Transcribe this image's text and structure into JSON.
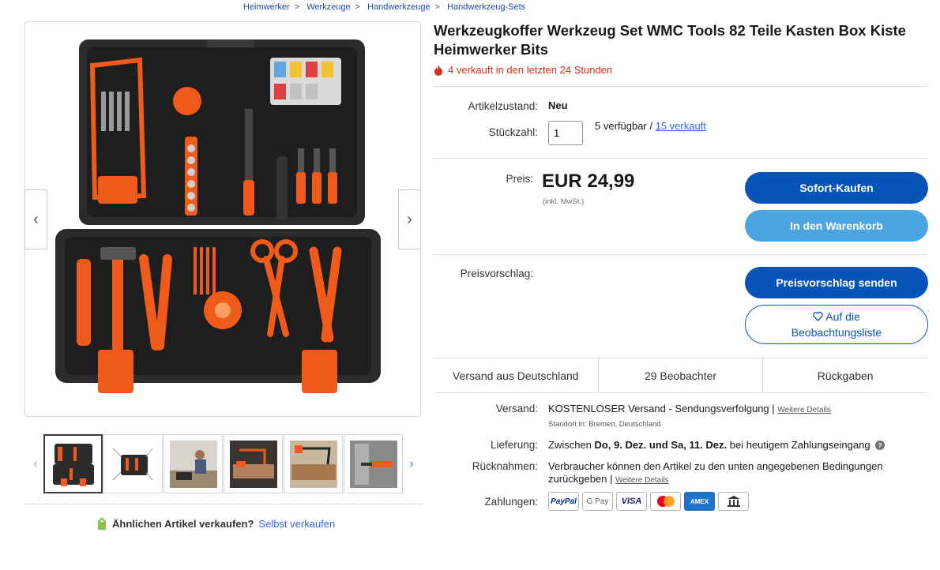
{
  "breadcrumb": [
    "Heimwerker",
    "Werkzeuge",
    "Handwerkzeuge",
    "Handwerkzeug-Sets"
  ],
  "breadcrumb_sep": ">",
  "listing": {
    "title": "Werkzeugkoffer Werkzeug Set WMC Tools 82 Teile Kasten Box Kiste Heimwerker Bits",
    "urgency": "4 verkauft in den letzten 24 Stunden"
  },
  "details": {
    "condition_label": "Artikelzustand:",
    "condition_value": "Neu",
    "quantity_label": "Stückzahl:",
    "quantity_value": "1",
    "available_text": "5 verfügbar / ",
    "sold_link": "15 verkauft"
  },
  "price": {
    "label": "Preis:",
    "value": "EUR 24,99",
    "tax_note": "(inkl. MwSt.)"
  },
  "buttons": {
    "buy_now": "Sofort-Kaufen",
    "add_to_cart": "In den Warenkorb",
    "offer_label": "Preisvorschlag:",
    "send_offer": "Preisvorschlag senden",
    "watchlist": "Auf die Beobachtungsliste"
  },
  "stats": [
    "Versand aus Deutschland",
    "29 Beobachter",
    "Rückgaben"
  ],
  "shipping": {
    "label": "Versand:",
    "value": "KOSTENLOSER Versand - Sendungsverfolgung",
    "details_link": "Weitere Details",
    "location": "Standort in:  Bremen, Deutschland"
  },
  "delivery": {
    "label": "Lieferung:",
    "prefix": "Zwischen ",
    "dates": "Do, 9. Dez. und Sa, 11. Dez.",
    "suffix": " bei heutigem Zahlungseingang"
  },
  "returns": {
    "label": "Rücknahmen:",
    "line1": "Verbraucher können den Artikel zu den unten angegebenen Bedingungen",
    "line2": "zurückgeben",
    "details_link": "Weitere Details"
  },
  "payments": {
    "label": "Zahlungen:",
    "methods": [
      "PayPal",
      "G Pay",
      "VISA",
      "",
      "AMEX",
      ""
    ]
  },
  "sell_similar": {
    "question": "Ähnlichen Artikel verkaufen?",
    "link": "Selbst verkaufen"
  },
  "colors": {
    "primary_button": "#0654ba",
    "secondary_button": "#4ca5e0",
    "urgency": "#d92d20",
    "link": "#3665f3",
    "case_body": "#2b2b2b",
    "tool_accent": "#f05a1a"
  },
  "icons": [
    "fire-icon",
    "chevron-left-icon",
    "chevron-right-icon",
    "heart-icon",
    "tag-icon",
    "help-icon",
    "bank-icon",
    "mastercard-icon"
  ]
}
